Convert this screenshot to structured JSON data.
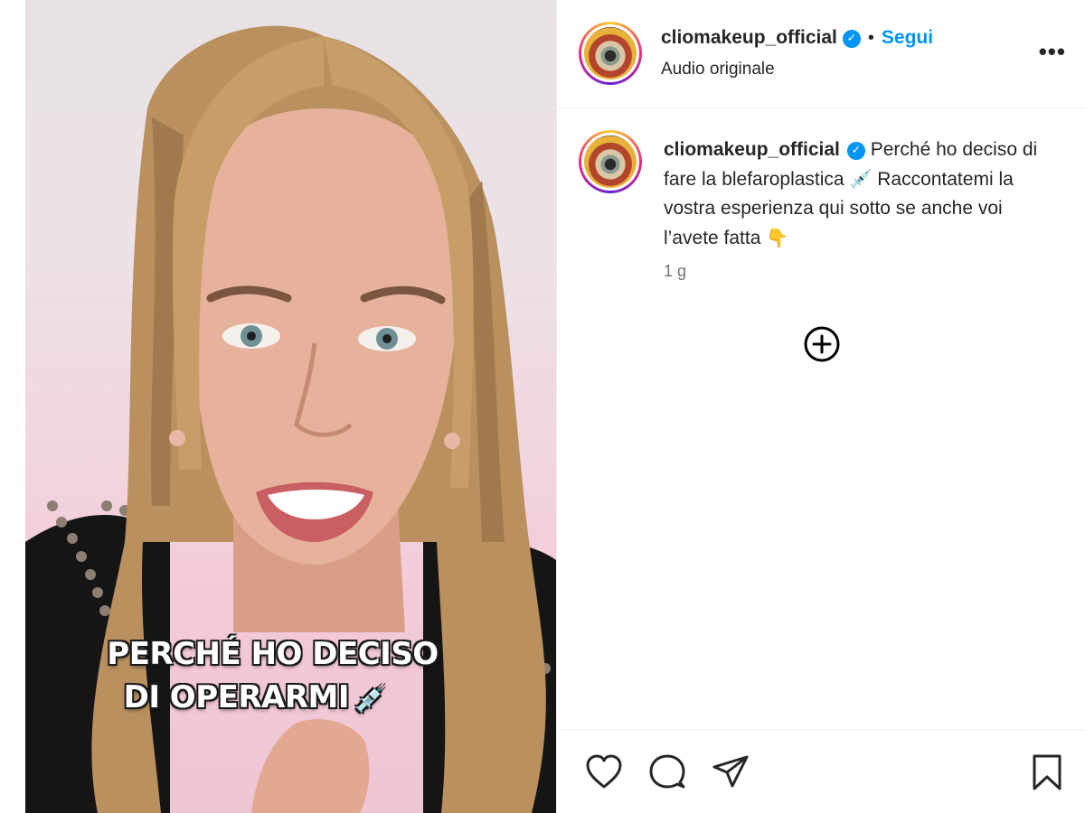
{
  "media": {
    "caption_line1": "PERCHÉ HO DECISO",
    "caption_line2": "DI OPERARMI",
    "caption_emoji": "💉"
  },
  "header": {
    "username": "cliomakeup_official",
    "verified_glyph": "✓",
    "separator": "•",
    "follow_label": "Segui",
    "subtitle": "Audio originale",
    "more_label": "•••"
  },
  "caption": {
    "username": "cliomakeup_official",
    "verified_glyph": "✓",
    "text_part1": "Perché ho deciso di fare la blefaroplastica",
    "emoji1": "💉",
    "text_part2": "Raccontatemi la vostra esperienza qui sotto se anche voi l’avete fatta",
    "emoji2": "👇",
    "timestamp": "1 g"
  },
  "icons": {
    "add_comments": "plus-circle-icon",
    "like": "heart-icon",
    "comment": "comment-icon",
    "share": "send-icon",
    "save": "bookmark-icon"
  },
  "colors": {
    "link_blue": "#0095f6",
    "text": "#262626",
    "muted": "#737373",
    "divider": "#efefef"
  }
}
